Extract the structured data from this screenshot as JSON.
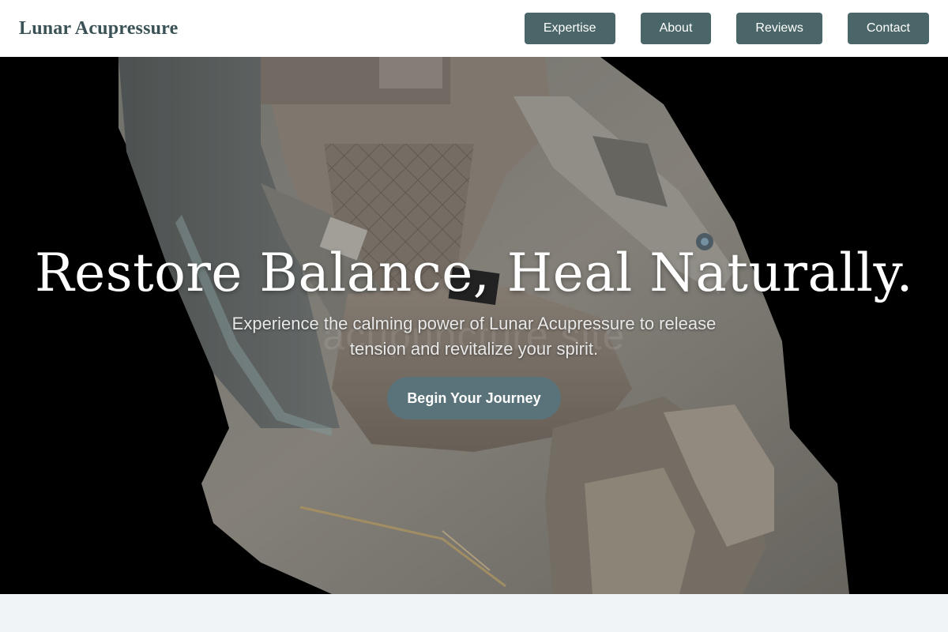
{
  "header": {
    "brand": "Lunar Acupressure",
    "nav": [
      {
        "label": "Expertise"
      },
      {
        "label": "About"
      },
      {
        "label": "Reviews"
      },
      {
        "label": "Contact"
      }
    ]
  },
  "hero": {
    "title": "Restore Balance, Heal Naturally.",
    "subtitle": "Experience the calming power of Lunar Acupressure to release tension and revitalize your spirit.",
    "watermark": "acupuncture site",
    "cta_label": "Begin Your Journey",
    "image_subject": "massage-chair"
  },
  "colors": {
    "brand_text": "#3a5255",
    "nav_button": "#4a6669",
    "cta_button": "#5a737a",
    "hero_background": "#000000",
    "page_background": "#f1f4f6"
  }
}
